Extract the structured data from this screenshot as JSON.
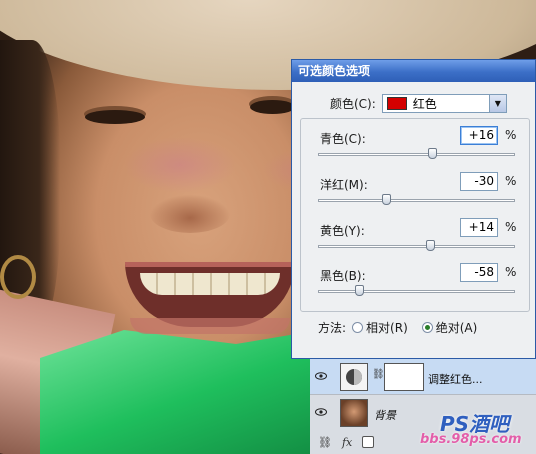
{
  "dialog": {
    "title": "可选颜色选项",
    "colors_label": "颜色(C):",
    "color_value": "红色",
    "swatch_color": "#d40000",
    "sliders": [
      {
        "label": "青色(C):",
        "value": "+16",
        "unit": "%",
        "level": 16
      },
      {
        "label": "洋红(M):",
        "value": "-30",
        "unit": "%",
        "level": -30
      },
      {
        "label": "黄色(Y):",
        "value": "+14",
        "unit": "%",
        "level": 14
      },
      {
        "label": "黑色(B):",
        "value": "-58",
        "unit": "%",
        "level": -58
      }
    ],
    "method_label": "方法:",
    "method_relative": "相对(R)",
    "method_absolute": "绝对(A)",
    "method_selected": "absolute"
  },
  "layers": {
    "adjustment_layer_name": "调整红色...",
    "background_layer_name": "背景",
    "bottom_icons": [
      "link-icon",
      "fx-icon",
      "mask-icon"
    ],
    "fx_label": "fx"
  },
  "watermark": {
    "brand": "PS酒吧",
    "url": "bbs.98ps.com"
  }
}
